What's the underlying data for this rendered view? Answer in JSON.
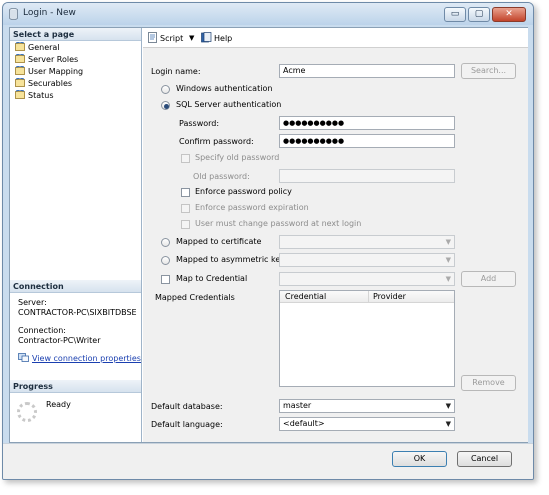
{
  "window": {
    "title": "Login - New"
  },
  "titlebar_buttons": {
    "minimize": "▭",
    "maximize": "▢",
    "close": "✕"
  },
  "left": {
    "select_page_header": "Select a page",
    "pages": [
      "General",
      "Server Roles",
      "User Mapping",
      "Securables",
      "Status"
    ],
    "connection_header": "Connection",
    "server_label": "Server:",
    "server_value": "CONTRACTOR-PC\\SIXBITDBSE",
    "connection_label": "Connection:",
    "connection_value": "Contractor-PC\\Writer",
    "view_props_link": "View connection properties",
    "progress_header": "Progress",
    "progress_status": "Ready"
  },
  "toolbar": {
    "script_label": "Script",
    "help_label": "Help"
  },
  "form": {
    "login_name_label": "Login name:",
    "login_name_value": "Acme",
    "search_button": "Search...",
    "windows_auth_label": "Windows authentication",
    "sql_auth_label": "SQL Server authentication",
    "password_label": "Password:",
    "password_value": "●●●●●●●●●●",
    "confirm_password_label": "Confirm password:",
    "confirm_password_value": "●●●●●●●●●●",
    "specify_old_password_label": "Specify old password",
    "old_password_label": "Old password:",
    "enforce_policy_label": "Enforce password policy",
    "enforce_expiration_label": "Enforce password expiration",
    "must_change_label": "User must change password at next login",
    "mapped_cert_label": "Mapped to certificate",
    "mapped_asym_label": "Mapped to asymmetric key",
    "map_credential_label": "Map to Credential",
    "add_button": "Add",
    "mapped_credentials_label": "Mapped Credentials",
    "grid_columns": [
      "Credential",
      "Provider"
    ],
    "remove_button": "Remove",
    "default_database_label": "Default database:",
    "default_database_value": "master",
    "default_language_label": "Default language:",
    "default_language_value": "<default>"
  },
  "buttons": {
    "ok": "OK",
    "cancel": "Cancel"
  }
}
